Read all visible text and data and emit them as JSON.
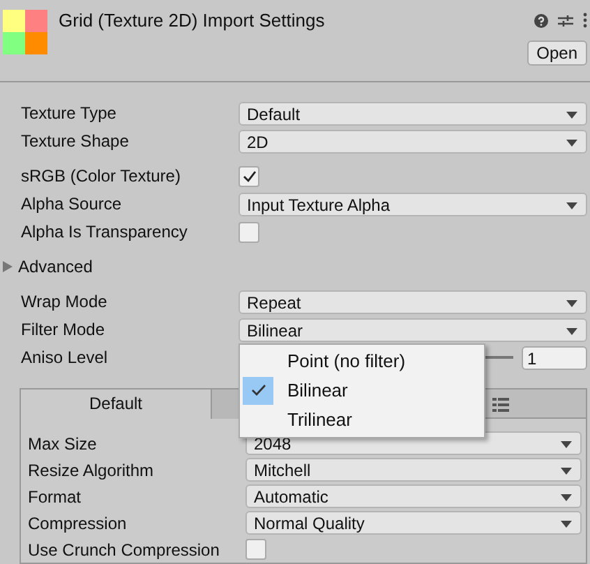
{
  "header": {
    "title": "Grid (Texture 2D) Import Settings",
    "open_button": "Open"
  },
  "groups": [
    [
      {
        "kind": "dropdown",
        "label": "Texture Type",
        "value": "Default"
      },
      {
        "kind": "dropdown",
        "label": "Texture Shape",
        "value": "2D"
      }
    ],
    [
      {
        "kind": "checkbox",
        "label": "sRGB (Color Texture)",
        "checked": true
      },
      {
        "kind": "dropdown",
        "label": "Alpha Source",
        "value": "Input Texture Alpha"
      },
      {
        "kind": "checkbox",
        "label": "Alpha Is Transparency",
        "checked": false
      }
    ],
    [
      {
        "kind": "foldout",
        "label": "Advanced",
        "expanded": false
      }
    ],
    [
      {
        "kind": "dropdown",
        "label": "Wrap Mode",
        "value": "Repeat"
      },
      {
        "kind": "dropdown",
        "label": "Filter Mode",
        "value": "Bilinear"
      },
      {
        "kind": "slider",
        "label": "Aniso Level",
        "reading": "1"
      }
    ]
  ],
  "menu": [
    {
      "label": "Point (no filter)",
      "selected": false
    },
    {
      "label": "Bilinear",
      "selected": true
    },
    {
      "label": "Trilinear",
      "selected": false
    }
  ],
  "platform": {
    "tabs": [
      {
        "label": "Default",
        "selected": true
      },
      {
        "selected": false
      }
    ],
    "rows": [
      {
        "kind": "dropdown",
        "label": "Max Size",
        "value": "2048"
      },
      {
        "kind": "dropdown",
        "label": "Resize Algorithm",
        "value": "Mitchell"
      },
      {
        "kind": "dropdown",
        "label": "Format",
        "value": "Automatic"
      },
      {
        "kind": "dropdown",
        "label": "Compression",
        "value": "Normal Quality"
      },
      {
        "kind": "checkbox",
        "label": "Use Crunch Compression",
        "checked": false
      }
    ]
  }
}
